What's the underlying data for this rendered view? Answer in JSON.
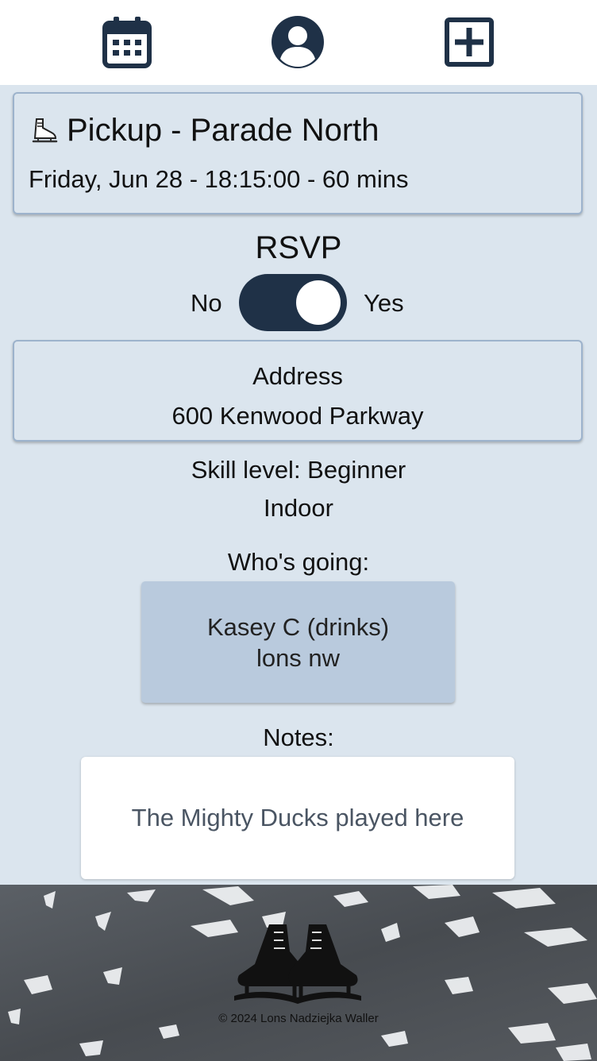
{
  "nav": {
    "calendar_icon": "calendar-icon",
    "profile_icon": "user-circle-icon",
    "add_icon": "plus-square-icon"
  },
  "event": {
    "icon": "ice-skate-icon",
    "title": "Pickup - Parade North",
    "when": "Friday, Jun 28 - 18:15:00 - 60 mins"
  },
  "rsvp": {
    "title": "RSVP",
    "no_label": "No",
    "yes_label": "Yes",
    "value": "Yes"
  },
  "address": {
    "label": "Address",
    "value": "600 Kenwood Parkway"
  },
  "details": {
    "skill": "Skill level: Beginner",
    "setting": "Indoor"
  },
  "attendees": {
    "label": "Who's going:",
    "list": [
      "Kasey C (drinks)",
      "lons nw"
    ]
  },
  "notes": {
    "label": "Notes:",
    "text": "The Mighty Ducks played here"
  },
  "footer": {
    "logo_icon": "hockey-skates-logo",
    "copyright": "© 2024 Lons Nadziejka Waller"
  },
  "colors": {
    "background": "#dbe5ee",
    "accent_dark": "#1f3147",
    "card_border": "#9db3cc",
    "attendee_bg": "#b9cadd"
  }
}
